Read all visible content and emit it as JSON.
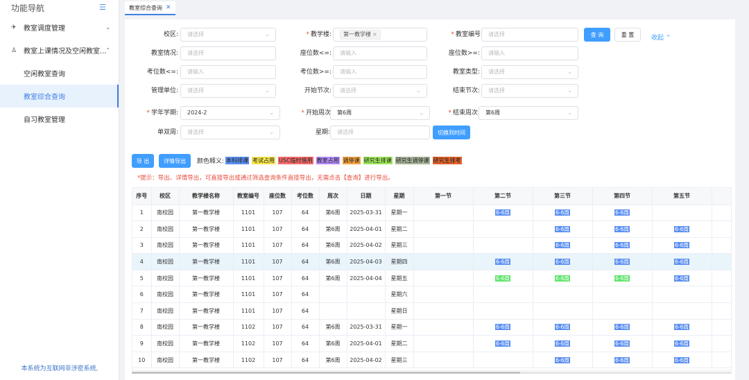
{
  "sidebar": {
    "title": "功能导航",
    "groups": [
      {
        "label": "教室调度管理",
        "icon": "schedule-icon",
        "expanded": false
      },
      {
        "label": "教室上课情况及空闲教室...",
        "icon": "user-icon",
        "expanded": true
      }
    ],
    "items": [
      {
        "label": "空闲教室查询",
        "active": false
      },
      {
        "label": "教室综合查询",
        "active": true
      },
      {
        "label": "自习教室管理",
        "active": false
      }
    ],
    "footer": "本系统为互联网非涉密系统,"
  },
  "tabs": [
    {
      "label": "教室综合查询",
      "close": "✕"
    }
  ],
  "filters": {
    "campus": {
      "label": "校区:",
      "placeholder": "请选择"
    },
    "building": {
      "label": "教学楼:",
      "value": "第一教学楼"
    },
    "room_no": {
      "label": "教室编号:",
      "placeholder": "请选择"
    },
    "room_status": {
      "label": "教室情况:",
      "placeholder": "请选择"
    },
    "seat_le": {
      "label": "座位数<=:",
      "placeholder": "请输入"
    },
    "seat_ge": {
      "label": "座位数>=:",
      "placeholder": "请输入"
    },
    "exam_le": {
      "label": "考位数<=:",
      "placeholder": "请输入"
    },
    "exam_ge": {
      "label": "考位数>=:",
      "placeholder": "请输入"
    },
    "room_type": {
      "label": "教室类型:",
      "placeholder": "请选择"
    },
    "dept": {
      "label": "管理单位:",
      "placeholder": "请选择"
    },
    "start_period": {
      "label": "开始节次:",
      "placeholder": "请选择"
    },
    "end_period": {
      "label": "结束节次:",
      "placeholder": "请选择"
    },
    "term": {
      "label": "学年学期:",
      "value": "2024-2"
    },
    "start_week": {
      "label": "开始周次:",
      "value": "第6周"
    },
    "end_week": {
      "label": "结束周次:",
      "value": "第6周"
    },
    "odd_even": {
      "label": "单双周:",
      "placeholder": "请选择"
    },
    "weekday": {
      "label": "星期:",
      "placeholder": "请选择"
    }
  },
  "buttons": {
    "query": "查 询",
    "reset": "重 置",
    "collapse": "收起 ⌃",
    "switch_time": "切换到时间",
    "export": "导 出",
    "export_detail": "详情导出"
  },
  "legend": {
    "title": "颜色释义:",
    "items": [
      {
        "label": "本科排课",
        "color": "#5b8ff0"
      },
      {
        "label": "考试占用",
        "color": "#f5e44a"
      },
      {
        "label": "USC临时借用",
        "color": "#f56c6c"
      },
      {
        "label": "教室占用",
        "color": "#b38af5"
      },
      {
        "label": "调停课",
        "color": "#f5a442"
      },
      {
        "label": "研究生排课",
        "color": "#9fe85a"
      },
      {
        "label": "研究生调停课",
        "color": "#a8b69a"
      },
      {
        "label": "研究生排考",
        "color": "#e0632c"
      }
    ]
  },
  "hint": "*提示：导出、详情导出，可直接导出或通过筛选查询条件直接导出，无需点击【查询】进行导出。",
  "table": {
    "headers": [
      "序号",
      "校区",
      "教学楼名称",
      "教室编号",
      "座位数",
      "考位数",
      "周次",
      "日期",
      "星期",
      "第一节",
      "第二节",
      "第三节",
      "第四节",
      "第五节"
    ],
    "rows": [
      {
        "c": [
          "1",
          "南校园",
          "第一教学楼",
          "1101",
          "107",
          "64",
          "第6周",
          "2025-03-31",
          "星期一"
        ],
        "p": [
          "",
          "b",
          "b",
          "b",
          ""
        ]
      },
      {
        "c": [
          "2",
          "南校园",
          "第一教学楼",
          "1101",
          "107",
          "64",
          "第6周",
          "2025-04-01",
          "星期二"
        ],
        "p": [
          "",
          "",
          "b",
          "b",
          "b"
        ]
      },
      {
        "c": [
          "3",
          "南校园",
          "第一教学楼",
          "1101",
          "107",
          "64",
          "第6周",
          "2025-04-02",
          "星期三"
        ],
        "p": [
          "",
          "",
          "b",
          "b",
          "b"
        ]
      },
      {
        "c": [
          "4",
          "南校园",
          "第一教学楼",
          "1101",
          "107",
          "64",
          "第6周",
          "2025-04-03",
          "星期四"
        ],
        "p": [
          "",
          "b",
          "b",
          "b",
          "b"
        ],
        "hl": true
      },
      {
        "c": [
          "5",
          "南校园",
          "第一教学楼",
          "1101",
          "107",
          "64",
          "第6周",
          "2025-04-04",
          "星期五"
        ],
        "p": [
          "",
          "g",
          "g",
          "g",
          "b"
        ]
      },
      {
        "c": [
          "6",
          "南校园",
          "第一教学楼",
          "1101",
          "107",
          "64",
          "",
          "",
          "星期六"
        ],
        "p": [
          "",
          "",
          "",
          "",
          ""
        ]
      },
      {
        "c": [
          "7",
          "南校园",
          "第一教学楼",
          "1101",
          "107",
          "64",
          "",
          "",
          "星期日"
        ],
        "p": [
          "",
          "",
          "",
          "",
          ""
        ]
      },
      {
        "c": [
          "8",
          "南校园",
          "第一教学楼",
          "1102",
          "107",
          "64",
          "第6周",
          "2025-03-31",
          "星期一"
        ],
        "p": [
          "",
          "b",
          "b",
          "b",
          "b"
        ]
      },
      {
        "c": [
          "9",
          "南校园",
          "第一教学楼",
          "1102",
          "107",
          "64",
          "第6周",
          "2025-04-01",
          "星期二"
        ],
        "p": [
          "",
          "b",
          "b",
          "b",
          "b"
        ]
      },
      {
        "c": [
          "10",
          "南校园",
          "第一教学楼",
          "1102",
          "107",
          "64",
          "第6周",
          "2025-04-02",
          "星期三"
        ],
        "p": [
          "",
          "",
          "b",
          "b",
          "b"
        ]
      }
    ],
    "week_label": "6-6周"
  }
}
